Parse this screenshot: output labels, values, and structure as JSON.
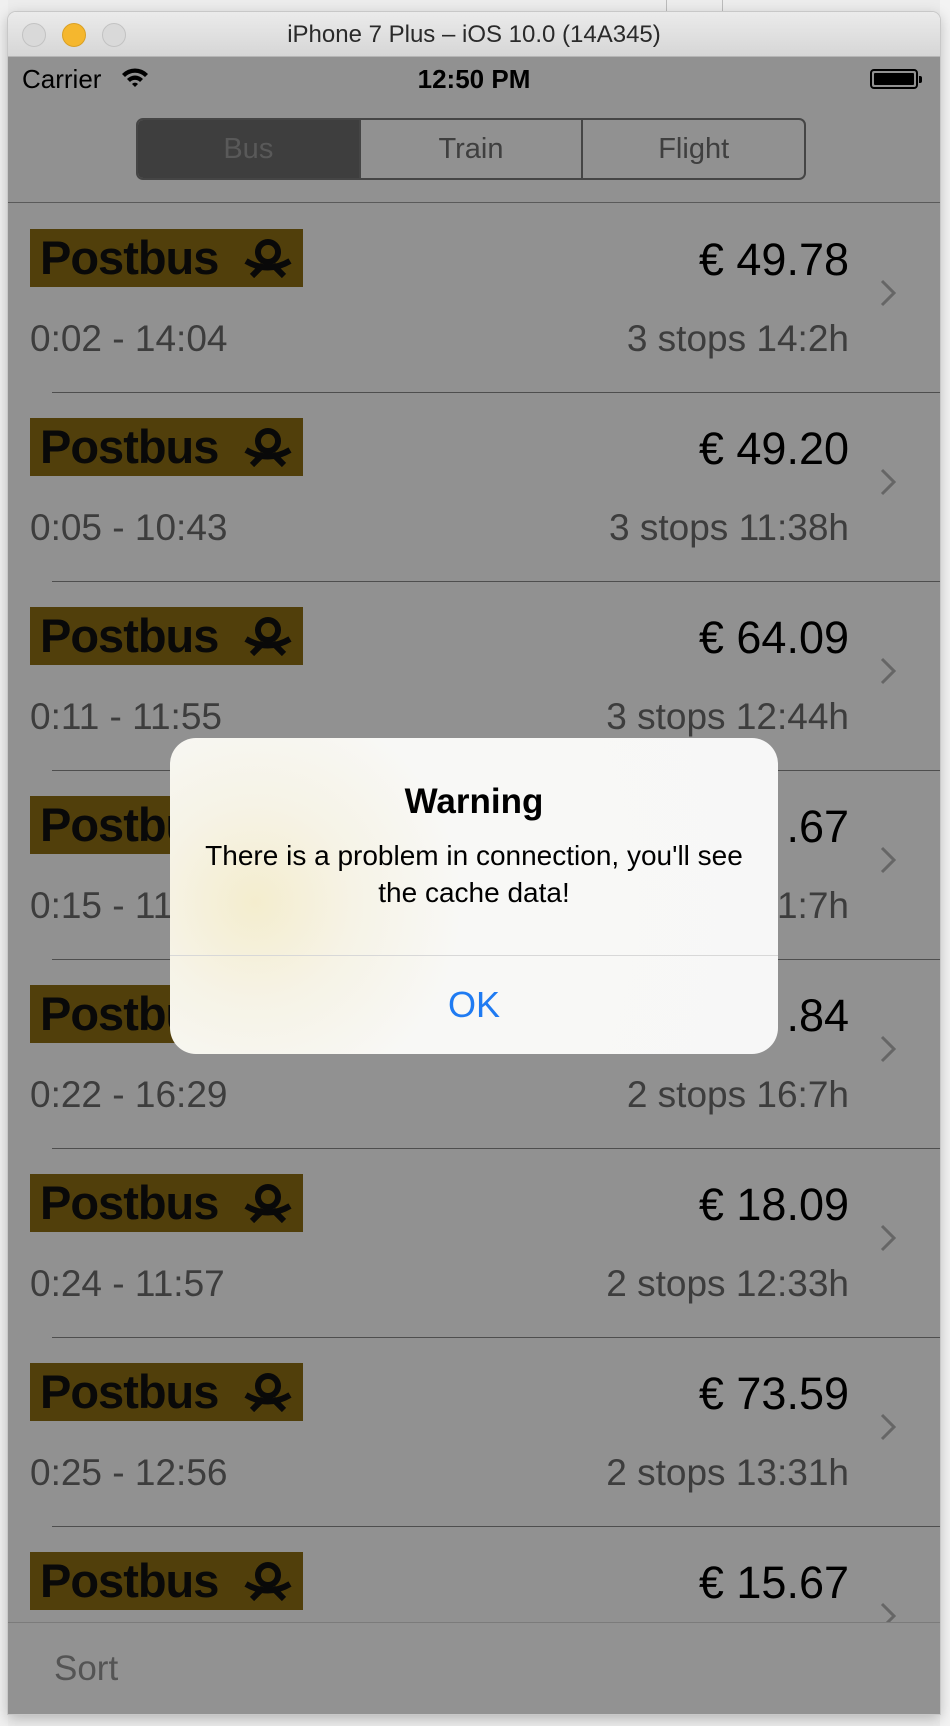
{
  "window": {
    "title": "iPhone 7 Plus – iOS 10.0 (14A345)"
  },
  "status_bar": {
    "carrier": "Carrier",
    "time": "12:50 PM"
  },
  "segments": [
    {
      "label": "Bus",
      "selected": true
    },
    {
      "label": "Train",
      "selected": false
    },
    {
      "label": "Flight",
      "selected": false
    }
  ],
  "rows": [
    {
      "logo": "Postbus",
      "price": "€ 49.78",
      "times": "0:02 - 14:04",
      "stops": "3 stops 14:2h"
    },
    {
      "logo": "Postbus",
      "price": "€ 49.20",
      "times": "0:05 - 10:43",
      "stops": "3 stops 11:38h"
    },
    {
      "logo": "Postbus",
      "price": "€ 64.09",
      "times": "0:11 - 11:55",
      "stops": "3 stops 12:44h"
    },
    {
      "logo": "Postbus",
      "price": ".67",
      "times": "0:15 - 11",
      "stops": "1:7h"
    },
    {
      "logo": "Postbus",
      "price": ".84",
      "times": "0:22 - 16:29",
      "stops": "2 stops 16:7h"
    },
    {
      "logo": "Postbus",
      "price": "€ 18.09",
      "times": "0:24 - 11:57",
      "stops": "2 stops 12:33h"
    },
    {
      "logo": "Postbus",
      "price": "€ 73.59",
      "times": "0:25 - 12:56",
      "stops": "2 stops 13:31h"
    },
    {
      "logo": "Postbus",
      "price": "€ 15.67",
      "times": "",
      "stops": ""
    }
  ],
  "toolbar": {
    "sort_label": "Sort"
  },
  "alert": {
    "title": "Warning",
    "message": "There is a problem in connection, you'll see the cache data!",
    "ok_label": "OK"
  },
  "colors": {
    "logo_yellow_dimmed": "#8f7014",
    "alert_button_blue": "#1f7bf2",
    "traffic_light_minimize": "#f5b72e"
  },
  "icons": {
    "row_logo_emblem": "posthorn-icon",
    "row_disclosure": "chevron-right-icon",
    "status_wifi": "wifi-icon",
    "status_battery": "battery-icon"
  }
}
